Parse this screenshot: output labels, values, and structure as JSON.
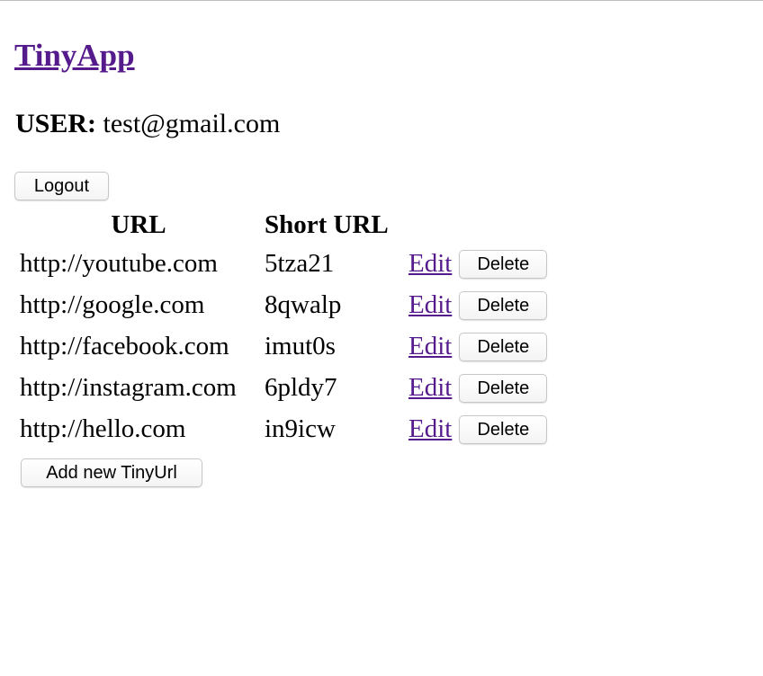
{
  "app": {
    "brand": "TinyApp"
  },
  "user": {
    "label": "USER:",
    "email": "test@gmail.com"
  },
  "actions": {
    "logout_label": "Logout",
    "add_label": "Add new TinyUrl"
  },
  "table": {
    "headers": {
      "url": "URL",
      "short_url": "Short URL"
    },
    "rows": [
      {
        "url": "http://youtube.com",
        "short": "5tza21",
        "edit": "Edit",
        "delete": "Delete"
      },
      {
        "url": "http://google.com",
        "short": "8qwalp",
        "edit": "Edit",
        "delete": "Delete"
      },
      {
        "url": "http://facebook.com",
        "short": "imut0s",
        "edit": "Edit",
        "delete": "Delete"
      },
      {
        "url": "http://instagram.com",
        "short": "6pldy7",
        "edit": "Edit",
        "delete": "Delete"
      },
      {
        "url": "http://hello.com",
        "short": "in9icw",
        "edit": "Edit",
        "delete": "Delete"
      }
    ]
  },
  "colors": {
    "link": "#551a8b",
    "text": "#000000",
    "background": "#ffffff"
  }
}
